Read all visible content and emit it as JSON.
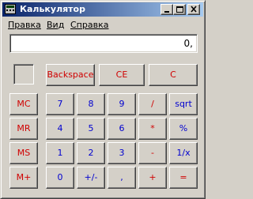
{
  "window": {
    "title": "Калькулятор",
    "minimize_icon": "minimize-icon",
    "maximize_icon": "maximize-icon",
    "close_icon": "close-icon",
    "app_icon": "calculator-icon"
  },
  "menu": {
    "items": [
      {
        "label": "Правка"
      },
      {
        "label": "Вид"
      },
      {
        "label": "Справка"
      }
    ]
  },
  "display": {
    "value": "0,"
  },
  "buttons": {
    "backspace": "Backspace",
    "ce": "CE",
    "c": "C",
    "mc": "MC",
    "mr": "MR",
    "ms": "MS",
    "mplus": "M+",
    "d7": "7",
    "d8": "8",
    "d9": "9",
    "div": "/",
    "sqrt": "sqrt",
    "d4": "4",
    "d5": "5",
    "d6": "6",
    "mul": "*",
    "percent": "%",
    "d1": "1",
    "d2": "2",
    "d3": "3",
    "sub": "-",
    "recip": "1/x",
    "d0": "0",
    "sign": "+/-",
    "decimal": ",",
    "add": "+",
    "equals": "="
  },
  "colors": {
    "title_start": "#0a246a",
    "title_end": "#a6caf0",
    "face": "#d4d0c8",
    "red_label": "#d00000",
    "blue_label": "#0000d0"
  }
}
